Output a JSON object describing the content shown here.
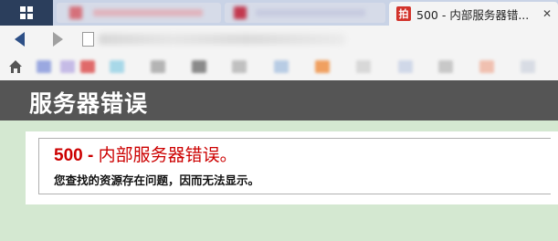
{
  "browser": {
    "active_tab": {
      "favicon_text": "拍",
      "title": "500 - 内部服务器错...",
      "close_glyph": "✕"
    }
  },
  "page": {
    "header_title": "服务器错误",
    "error_code": "500 -",
    "error_title": "内部服务器错误。",
    "error_message": "您查找的资源存在问题，因而无法显示。"
  },
  "colors": {
    "header_bg": "#555555",
    "error_red": "#cc0000",
    "page_bg": "#d4e8d1"
  }
}
